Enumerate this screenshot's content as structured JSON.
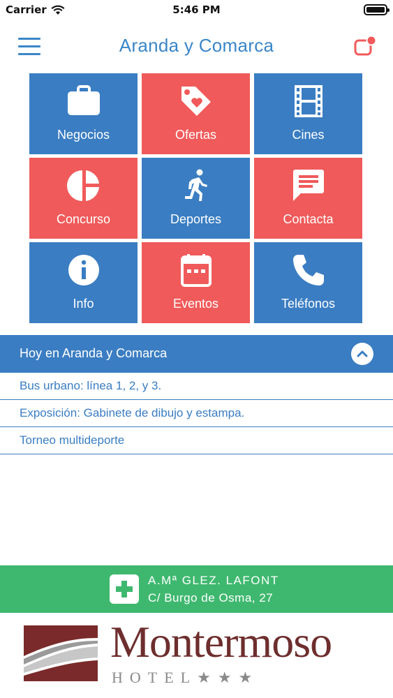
{
  "status_bar": {
    "carrier": "Carrier",
    "time": "5:46 PM"
  },
  "nav": {
    "title": "Aranda y Comarca",
    "menu_icon": "hamburger-menu-icon",
    "notification_icon": "notification-badge-icon"
  },
  "colors": {
    "primary_blue": "#3a7dc2",
    "accent_red": "#f05a5a",
    "pharmacy_green": "#3fb86f",
    "brand_maroon": "#6e2e2e"
  },
  "tiles": [
    {
      "label": "Negocios",
      "icon": "briefcase-icon",
      "color": "blue"
    },
    {
      "label": "Ofertas",
      "icon": "tag-heart-icon",
      "color": "red"
    },
    {
      "label": "Cines",
      "icon": "film-strip-icon",
      "color": "blue"
    },
    {
      "label": "Concurso",
      "icon": "pie-chart-icon",
      "color": "red"
    },
    {
      "label": "Deportes",
      "icon": "running-person-icon",
      "color": "blue"
    },
    {
      "label": "Contacta",
      "icon": "chat-bubble-icon",
      "color": "red"
    },
    {
      "label": "Info",
      "icon": "info-icon",
      "color": "blue"
    },
    {
      "label": "Eventos",
      "icon": "calendar-icon",
      "color": "red"
    },
    {
      "label": "Teléfonos",
      "icon": "phone-icon",
      "color": "blue"
    }
  ],
  "today": {
    "title": "Hoy en Aranda y Comarca",
    "toggle_icon": "chevron-up-icon",
    "items": [
      "Bus urbano: línea 1, 2, y 3.",
      "Exposición: Gabinete de dibujo y estampa.",
      "Torneo multideporte"
    ]
  },
  "pharmacy": {
    "icon": "pharmacy-cross-icon",
    "name": "A.Mª GLEZ. LAFONT",
    "address": "C/ Burgo de Osma, 27"
  },
  "ad": {
    "brand": "Montermoso",
    "subtitle": "HOTEL★★★"
  }
}
